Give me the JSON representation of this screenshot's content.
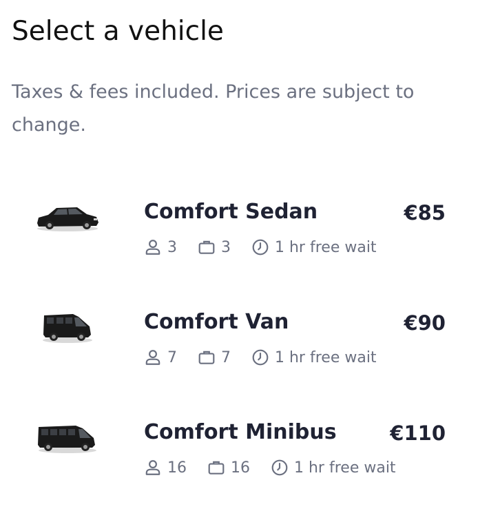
{
  "page": {
    "title": "Select a vehicle",
    "subtitle": "Taxes & fees included. Prices are subject to change."
  },
  "vehicles": [
    {
      "name": "Comfort Sedan",
      "price": "€85",
      "passengers": "3",
      "luggage": "3",
      "wait": "1 hr free wait",
      "image": "sedan-image"
    },
    {
      "name": "Comfort Van",
      "price": "€90",
      "passengers": "7",
      "luggage": "7",
      "wait": "1 hr free wait",
      "image": "van-image"
    },
    {
      "name": "Comfort Minibus",
      "price": "€110",
      "passengers": "16",
      "luggage": "16",
      "wait": "1 hr free wait",
      "image": "minibus-image"
    }
  ],
  "icons": {
    "passenger": "person-icon",
    "luggage": "luggage-icon",
    "wait": "clock-icon"
  },
  "colors": {
    "heading": "#111111",
    "muted": "#6b7080",
    "dark": "#1f2233"
  }
}
